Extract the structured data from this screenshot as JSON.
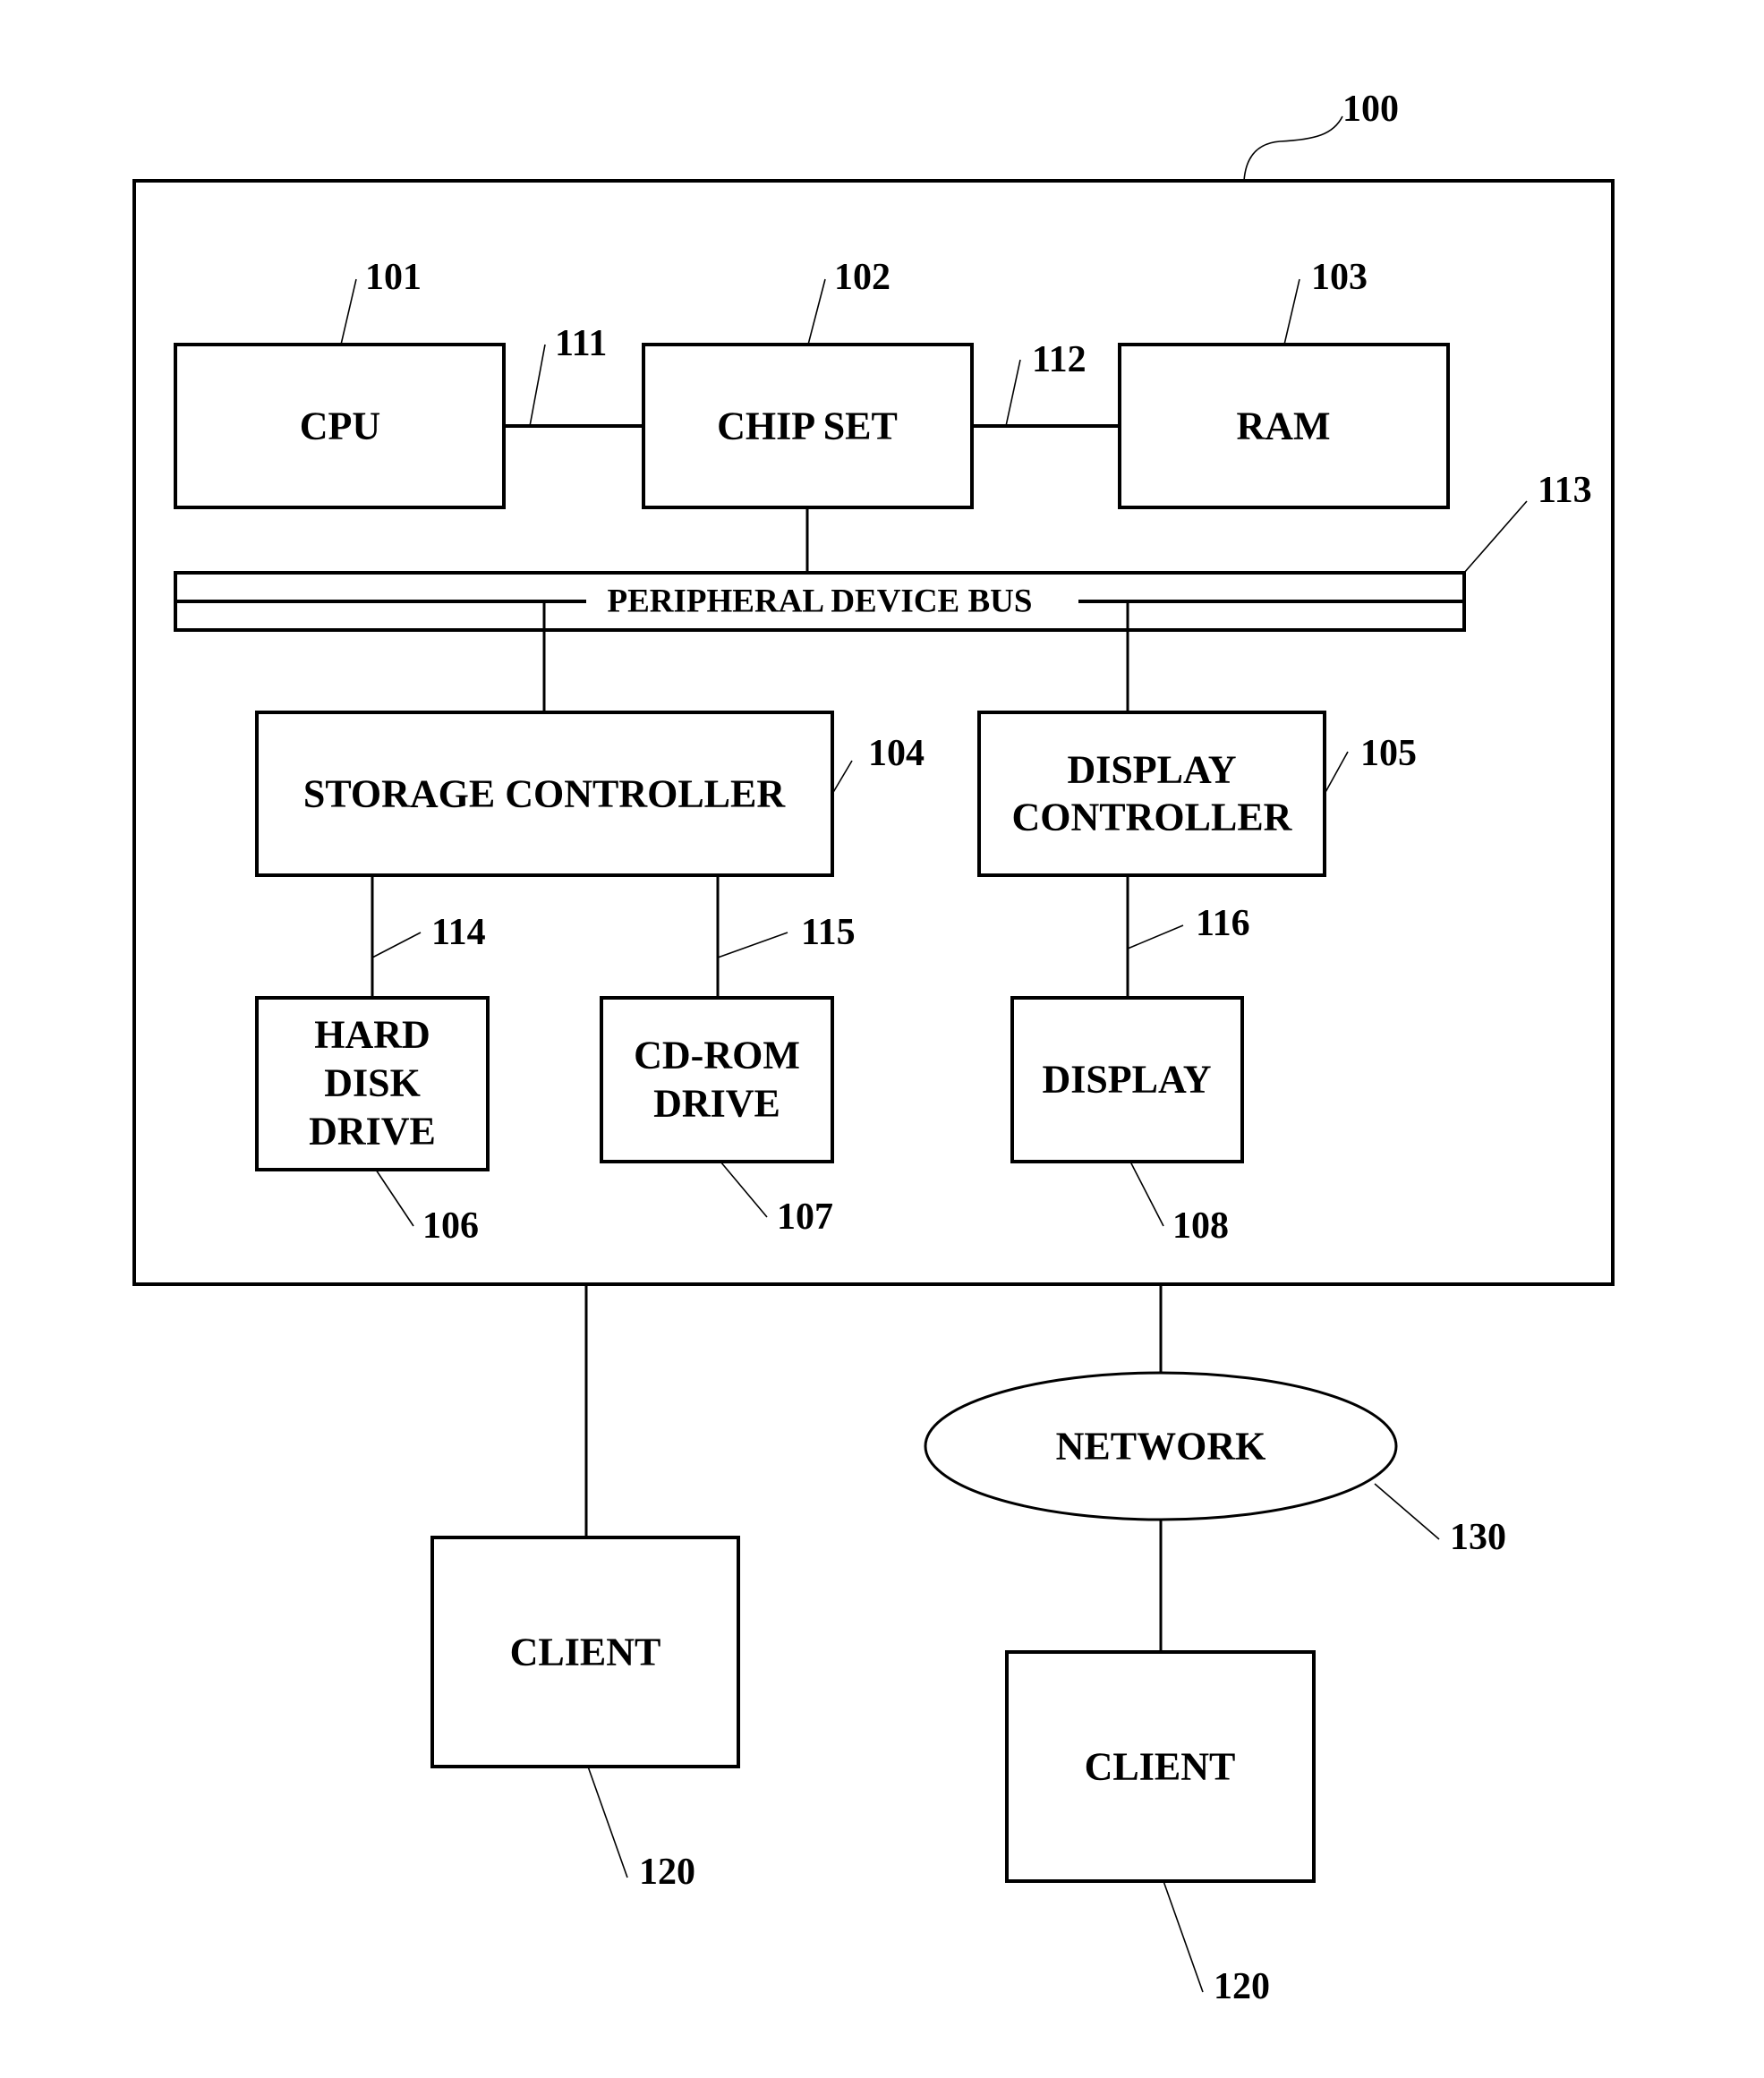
{
  "diagram": {
    "system": {
      "ref": "100"
    },
    "components": {
      "cpu": {
        "label": "CPU",
        "ref": "101"
      },
      "chipset": {
        "label": "CHIP SET",
        "ref": "102"
      },
      "ram": {
        "label": "RAM",
        "ref": "103"
      },
      "storage_controller": {
        "label": "STORAGE CONTROLLER",
        "ref": "104"
      },
      "display_controller": {
        "lines": [
          "DISPLAY",
          "CONTROLLER"
        ],
        "ref": "105"
      },
      "hard_disk": {
        "lines": [
          "HARD",
          "DISK",
          "DRIVE"
        ],
        "ref": "106"
      },
      "cdrom": {
        "lines": [
          "CD-ROM",
          "DRIVE"
        ],
        "ref": "107"
      },
      "display": {
        "label": "DISPLAY",
        "ref": "108"
      },
      "client_1": {
        "label": "CLIENT",
        "ref": "120"
      },
      "client_2": {
        "label": "CLIENT",
        "ref": "120"
      },
      "network": {
        "label": "NETWORK",
        "ref": "130"
      }
    },
    "connections": {
      "cpu_chipset": {
        "ref": "111"
      },
      "chipset_ram": {
        "ref": "112"
      },
      "peripheral_bus": {
        "label": "PERIPHERAL DEVICE BUS",
        "ref": "113"
      },
      "storage_hdd": {
        "ref": "114"
      },
      "storage_cdrom": {
        "ref": "115"
      },
      "displayctrl_display": {
        "ref": "116"
      }
    }
  }
}
